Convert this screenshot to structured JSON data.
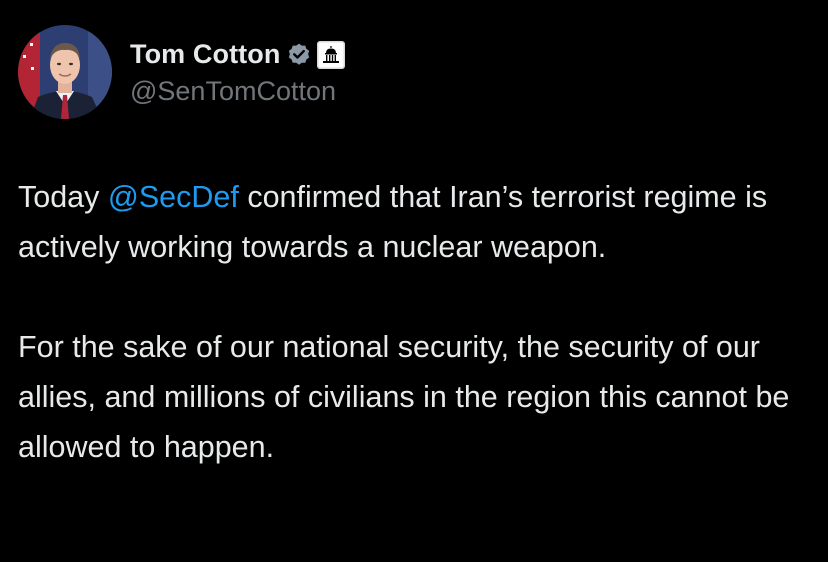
{
  "author": {
    "display_name": "Tom Cotton",
    "handle": "@SenTomCotton",
    "verified_badge_icon": "verified-check-icon",
    "verified_badge_color": "#8b98a5",
    "affiliation_badge_icon": "capitol-building-icon"
  },
  "tweet": {
    "paragraph_1": {
      "before_mention": "Today ",
      "mention": "@SecDef",
      "after_mention": " confirmed that Iran’s terrorist regime is actively working towards a nuclear weapon."
    },
    "paragraph_2": "For the sake of our national security, the security of our allies, and millions of civilians in the region this cannot be allowed to happen."
  },
  "colors": {
    "background": "#000000",
    "text_primary": "#e7e9ea",
    "text_secondary": "#71767b",
    "mention": "#1d9bf0"
  }
}
